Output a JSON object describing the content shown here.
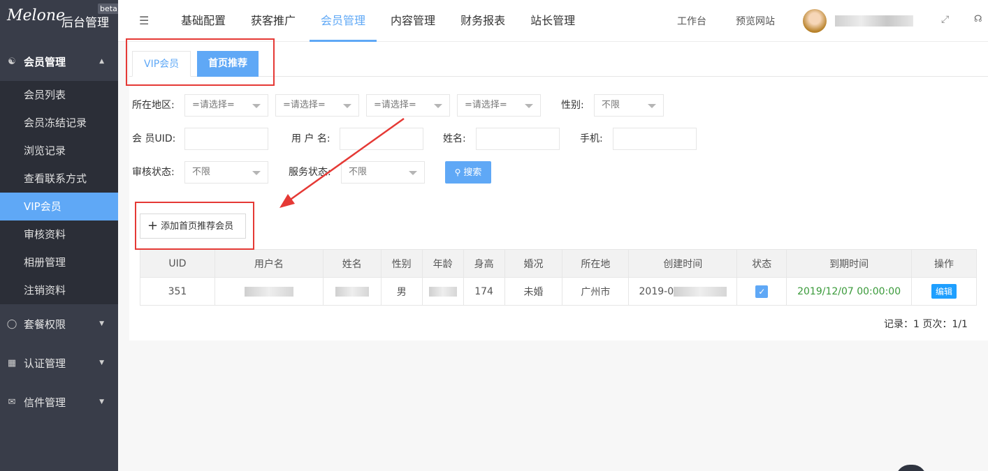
{
  "sidebar": {
    "logo_script": "Melone",
    "logo_title": "后台管理",
    "beta": "beta",
    "groups": [
      {
        "label": "会员管理",
        "icon": "user-icon"
      },
      {
        "label": "套餐权限",
        "icon": "shield-icon"
      },
      {
        "label": "认证管理",
        "icon": "id-card-icon"
      },
      {
        "label": "信件管理",
        "icon": "mail-icon"
      }
    ],
    "member_items": [
      "会员列表",
      "会员冻结记录",
      "浏览记录",
      "查看联系方式",
      "VIP会员",
      "审核资料",
      "相册管理",
      "注销资料"
    ]
  },
  "topbar": {
    "nav": [
      "基础配置",
      "获客推广",
      "会员管理",
      "内容管理",
      "财务报表",
      "站长管理"
    ],
    "active_nav": "会员管理",
    "links": [
      "工作台",
      "预览网站"
    ]
  },
  "tabs": {
    "vip": "VIP会员",
    "home": "首页推荐"
  },
  "filters": {
    "region_label": "所在地区:",
    "select_placeholder": "=请选择=",
    "gender_label": "性别:",
    "gender_value": "不限",
    "uid_label": "会 员UID:",
    "username_label": "用 户 名:",
    "name_label": "姓名:",
    "phone_label": "手机:",
    "audit_label": "审核状态:",
    "audit_value": "不限",
    "service_label": "服务状态:",
    "service_value": "不限",
    "search_label": "搜索"
  },
  "add_button": "添加首页推荐会员",
  "table": {
    "headers": [
      "UID",
      "用户名",
      "姓名",
      "性别",
      "年龄",
      "身高",
      "婚况",
      "所在地",
      "创建时间",
      "状态",
      "到期时间",
      "操作"
    ],
    "row": {
      "uid": "351",
      "gender": "男",
      "height": "174",
      "marriage": "未婚",
      "location": "广州市",
      "created_prefix": "2019-0",
      "expire": "2019/12/07 00:00:00",
      "edit": "编辑"
    }
  },
  "pager": {
    "text": "记录：1  页次：1/1"
  },
  "colors": {
    "accent": "#5fa8f6",
    "sidebar": "#393d49",
    "annotation": "#e53935"
  }
}
